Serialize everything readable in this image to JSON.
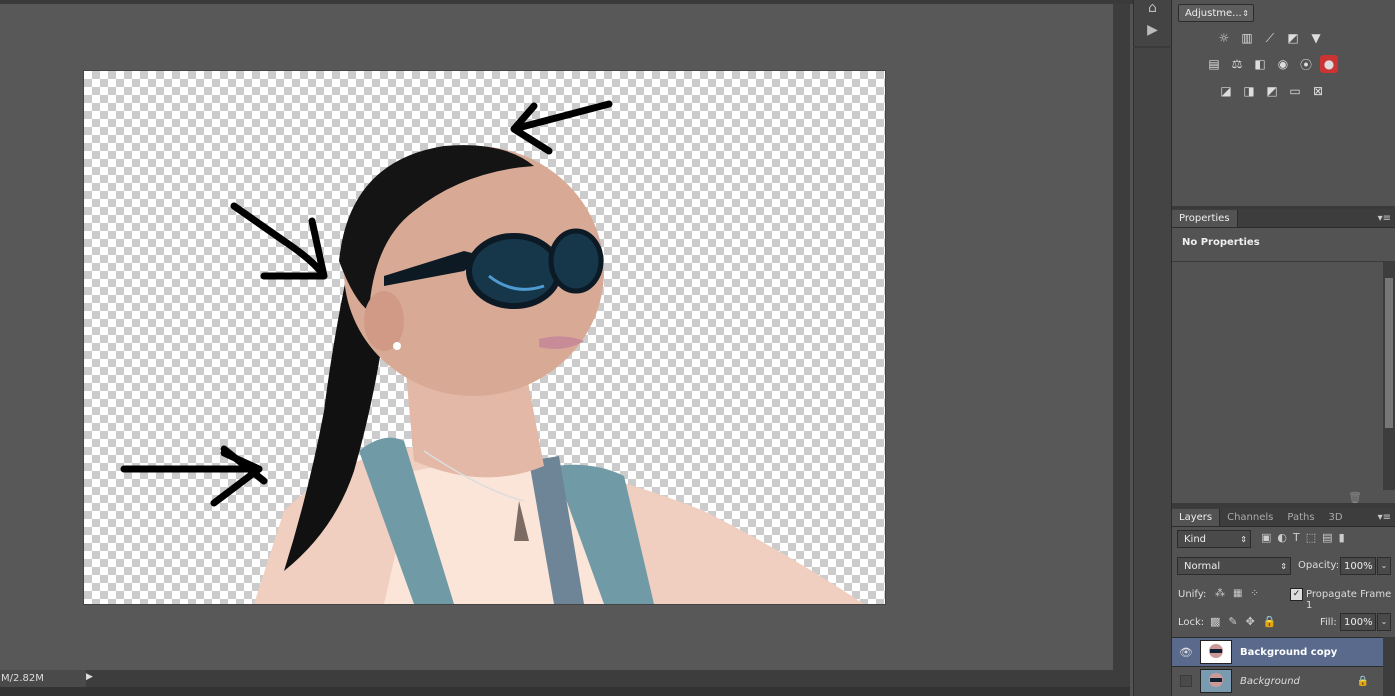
{
  "status": {
    "doc_size": "M/2.82M"
  },
  "adjustments": {
    "button_label": "Adjustme...",
    "row1": [
      "brightness-icon",
      "levels-icon",
      "curves-icon",
      "exposure-icon",
      "vibrance-icon"
    ],
    "row2": [
      "hue-saturation-icon",
      "color-balance-icon",
      "black-white-icon",
      "photo-filter-icon",
      "channel-mixer-icon",
      "color-lookup-icon"
    ],
    "row3": [
      "invert-icon",
      "posterize-icon",
      "threshold-icon",
      "gradient-map-icon",
      "selective-color-icon"
    ]
  },
  "properties": {
    "tab_label": "Properties",
    "empty_text": "No Properties"
  },
  "layers_panel": {
    "tabs": [
      "Layers",
      "Channels",
      "Paths",
      "3D"
    ],
    "filter_kind": "Kind",
    "blend_mode": "Normal",
    "opacity_label": "Opacity:",
    "opacity_value": "100%",
    "unify_label": "Unify:",
    "propagate_label": "Propagate Frame 1",
    "lock_label": "Lock:",
    "fill_label": "Fill:",
    "fill_value": "100%",
    "layers": [
      {
        "name": "Background copy",
        "visible": true,
        "selected": true
      },
      {
        "name": "Background",
        "visible": false,
        "selected": false,
        "locked": true
      }
    ]
  },
  "colors": {
    "selected_layer": "#5a6a8c",
    "panel_bg": "#535353",
    "canvas_bg": "#585858"
  }
}
